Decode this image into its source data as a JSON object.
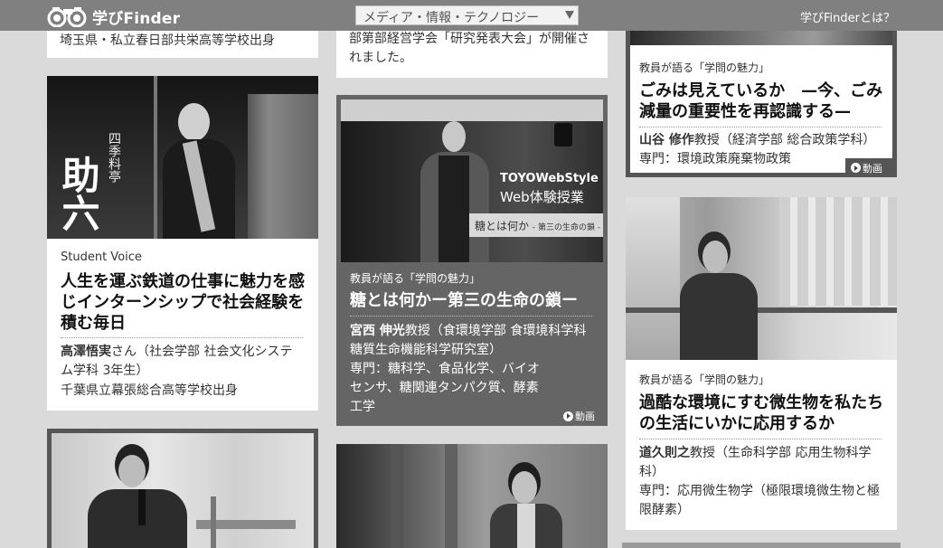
{
  "header": {
    "logo_text": "学びFinder",
    "category_select": "メディア・情報・テクノロジー",
    "about_link": "学びFinderとは？"
  },
  "cards": {
    "c1": {
      "school": "埼玉県・私立春日部共栄高等学校出身"
    },
    "c2": {
      "line1": "部第部経営学会「研究発表大会」が開催さ",
      "line2": "れました。"
    },
    "c3": {
      "category": "教員が語る「学問の魅力」",
      "title1": "ごみは見えているか　—今、ごみ",
      "title2": "減量の重要性を再認識する—",
      "name": "山谷 修作",
      "name_rest": "教授（経済学部 総合政策学科）",
      "specialty": "専門：環境政策廃棄物政策",
      "video": "動画"
    },
    "c4": {
      "photo_sign": "四季料亭",
      "photo_big": "助六",
      "category": "Student Voice",
      "title1": "人生を運ぶ鉄道の仕事に魅力を感",
      "title2": "じインターンシップで社会経験を",
      "title3": "積む毎日",
      "name": "高澤悟実",
      "name_rest": "さん（社会学部 社会文化システ",
      "name_rest2": "ム学科 3年生）",
      "school": "千葉県立幕張総合高等学校出身"
    },
    "c5": {
      "photo_brand": "TOYOWebStyle",
      "photo_sub": "Web体験授業",
      "photo_caption": "糖とは何か",
      "photo_caption_small": "- 第三の生命の鎖 -",
      "category": "教員が語る「学問の魅力」",
      "title": "糖とは何かー第三の生命の鎖ー",
      "name": "宮西 伸光",
      "name_rest": "教授（食環境学部 食環境科学科",
      "name_rest2": "糖質生命機能科学研究室）",
      "spec1": "専門：糖科学、食品化学、バイオ",
      "spec2": "センサ、糖関連タンパク質、酵素",
      "spec3": "工学",
      "video": "動画"
    },
    "c6": {
      "category": "教員が語る「学問の魅力」",
      "title1": "過酷な環境にすむ微生物を私たち",
      "title2": "の生活にいかに応用するか",
      "name": "道久則之",
      "name_rest": "教授（生命科学部 応用生物科学",
      "name_rest2": "科）",
      "spec1": "専門：応用微生物学（極限環境微生物と極",
      "spec2": "限酵素）"
    }
  },
  "colors": {
    "header_bg": "#808080",
    "page_bg": "#dadada",
    "dark_card": "#656565"
  }
}
